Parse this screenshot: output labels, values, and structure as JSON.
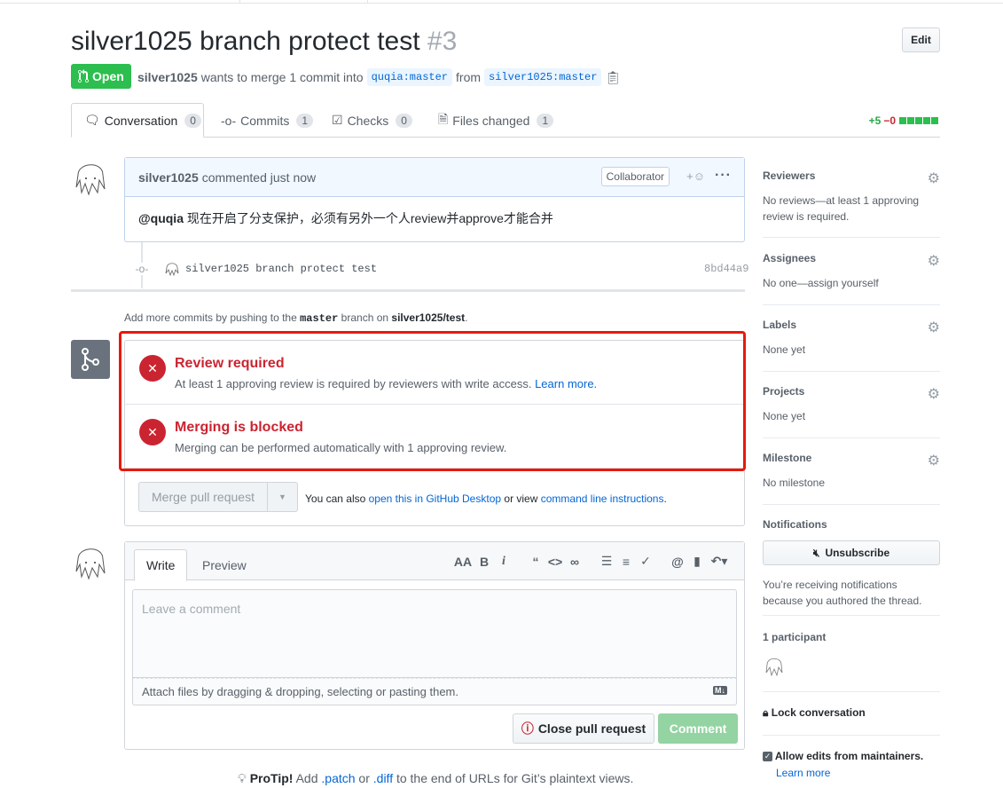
{
  "header": {
    "title": "silver1025 branch protect test",
    "number": "#3",
    "edit_label": "Edit",
    "state": "Open",
    "author": "silver1025",
    "merge_text": "wants to merge 1 commit into",
    "base_branch": "quqia:master",
    "from_text": "from",
    "head_branch": "silver1025:master"
  },
  "tabs": [
    {
      "label": "Conversation",
      "count": "0"
    },
    {
      "label": "Commits",
      "count": "1"
    },
    {
      "label": "Checks",
      "count": "0"
    },
    {
      "label": "Files changed",
      "count": "1"
    }
  ],
  "diffstat": {
    "additions": "+5",
    "deletions": "−0"
  },
  "comment": {
    "author": "silver1025",
    "time": "commented just now",
    "badge": "Collaborator",
    "mention": "@quqia",
    "body": " 现在开启了分支保护，必须有另外一个人review并approve才能合并"
  },
  "commit": {
    "message": "silver1025 branch protect test",
    "sha": "8bd44a9"
  },
  "add_more": {
    "prefix": "Add more commits by pushing to the",
    "branch": "master",
    "mid": "branch on",
    "repo": "silver1025/test",
    "suffix": "."
  },
  "merge_status": {
    "review_title": "Review required",
    "review_desc": "At least 1 approving review is required by reviewers with write access.",
    "learn_more": "Learn more.",
    "blocked_title": "Merging is blocked",
    "blocked_desc": "Merging can be performed automatically with 1 approving review.",
    "merge_button": "Merge pull request",
    "alt_prefix": "You can also",
    "alt_desktop": "open this in GitHub Desktop",
    "alt_mid": "or view",
    "alt_cli": "command line instructions",
    "alt_suffix": "."
  },
  "new_comment": {
    "write_tab": "Write",
    "preview_tab": "Preview",
    "placeholder": "Leave a comment",
    "attach_text": "Attach files by dragging & dropping, selecting or pasting them.",
    "close_button": "Close pull request",
    "comment_button": "Comment"
  },
  "protip": {
    "label": "ProTip!",
    "text1": "Add",
    "patch": ".patch",
    "or": "or",
    "diff": ".diff",
    "text2": "to the end of URLs for Git’s plaintext views."
  },
  "sidebar": {
    "reviewers_heading": "Reviewers",
    "reviewers_text": "No reviews—at least 1 approving review is required.",
    "assignees_heading": "Assignees",
    "assignees_text": "No one—assign yourself",
    "labels_heading": "Labels",
    "labels_text": "None yet",
    "projects_heading": "Projects",
    "projects_text": "None yet",
    "milestone_heading": "Milestone",
    "milestone_text": "No milestone",
    "notifications_heading": "Notifications",
    "unsubscribe_label": "Unsubscribe",
    "notifications_text": "You’re receiving notifications because you authored the thread.",
    "participants_heading": "1 participant",
    "lock_label": "Lock conversation",
    "allow_edits_label": "Allow edits from maintainers.",
    "learn_more": "Learn more"
  }
}
